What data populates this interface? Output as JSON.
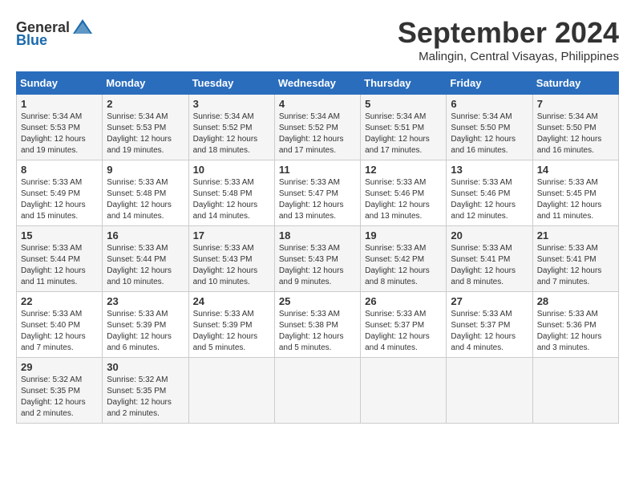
{
  "logo": {
    "general": "General",
    "blue": "Blue"
  },
  "title": "September 2024",
  "location": "Malingin, Central Visayas, Philippines",
  "headers": [
    "Sunday",
    "Monday",
    "Tuesday",
    "Wednesday",
    "Thursday",
    "Friday",
    "Saturday"
  ],
  "weeks": [
    [
      {
        "day": "1",
        "sunrise": "5:34 AM",
        "sunset": "5:53 PM",
        "daylight": "12 hours and 19 minutes."
      },
      {
        "day": "2",
        "sunrise": "5:34 AM",
        "sunset": "5:53 PM",
        "daylight": "12 hours and 19 minutes."
      },
      {
        "day": "3",
        "sunrise": "5:34 AM",
        "sunset": "5:52 PM",
        "daylight": "12 hours and 18 minutes."
      },
      {
        "day": "4",
        "sunrise": "5:34 AM",
        "sunset": "5:52 PM",
        "daylight": "12 hours and 17 minutes."
      },
      {
        "day": "5",
        "sunrise": "5:34 AM",
        "sunset": "5:51 PM",
        "daylight": "12 hours and 17 minutes."
      },
      {
        "day": "6",
        "sunrise": "5:34 AM",
        "sunset": "5:50 PM",
        "daylight": "12 hours and 16 minutes."
      },
      {
        "day": "7",
        "sunrise": "5:34 AM",
        "sunset": "5:50 PM",
        "daylight": "12 hours and 16 minutes."
      }
    ],
    [
      {
        "day": "8",
        "sunrise": "5:33 AM",
        "sunset": "5:49 PM",
        "daylight": "12 hours and 15 minutes."
      },
      {
        "day": "9",
        "sunrise": "5:33 AM",
        "sunset": "5:48 PM",
        "daylight": "12 hours and 14 minutes."
      },
      {
        "day": "10",
        "sunrise": "5:33 AM",
        "sunset": "5:48 PM",
        "daylight": "12 hours and 14 minutes."
      },
      {
        "day": "11",
        "sunrise": "5:33 AM",
        "sunset": "5:47 PM",
        "daylight": "12 hours and 13 minutes."
      },
      {
        "day": "12",
        "sunrise": "5:33 AM",
        "sunset": "5:46 PM",
        "daylight": "12 hours and 13 minutes."
      },
      {
        "day": "13",
        "sunrise": "5:33 AM",
        "sunset": "5:46 PM",
        "daylight": "12 hours and 12 minutes."
      },
      {
        "day": "14",
        "sunrise": "5:33 AM",
        "sunset": "5:45 PM",
        "daylight": "12 hours and 11 minutes."
      }
    ],
    [
      {
        "day": "15",
        "sunrise": "5:33 AM",
        "sunset": "5:44 PM",
        "daylight": "12 hours and 11 minutes."
      },
      {
        "day": "16",
        "sunrise": "5:33 AM",
        "sunset": "5:44 PM",
        "daylight": "12 hours and 10 minutes."
      },
      {
        "day": "17",
        "sunrise": "5:33 AM",
        "sunset": "5:43 PM",
        "daylight": "12 hours and 10 minutes."
      },
      {
        "day": "18",
        "sunrise": "5:33 AM",
        "sunset": "5:43 PM",
        "daylight": "12 hours and 9 minutes."
      },
      {
        "day": "19",
        "sunrise": "5:33 AM",
        "sunset": "5:42 PM",
        "daylight": "12 hours and 8 minutes."
      },
      {
        "day": "20",
        "sunrise": "5:33 AM",
        "sunset": "5:41 PM",
        "daylight": "12 hours and 8 minutes."
      },
      {
        "day": "21",
        "sunrise": "5:33 AM",
        "sunset": "5:41 PM",
        "daylight": "12 hours and 7 minutes."
      }
    ],
    [
      {
        "day": "22",
        "sunrise": "5:33 AM",
        "sunset": "5:40 PM",
        "daylight": "12 hours and 7 minutes."
      },
      {
        "day": "23",
        "sunrise": "5:33 AM",
        "sunset": "5:39 PM",
        "daylight": "12 hours and 6 minutes."
      },
      {
        "day": "24",
        "sunrise": "5:33 AM",
        "sunset": "5:39 PM",
        "daylight": "12 hours and 5 minutes."
      },
      {
        "day": "25",
        "sunrise": "5:33 AM",
        "sunset": "5:38 PM",
        "daylight": "12 hours and 5 minutes."
      },
      {
        "day": "26",
        "sunrise": "5:33 AM",
        "sunset": "5:37 PM",
        "daylight": "12 hours and 4 minutes."
      },
      {
        "day": "27",
        "sunrise": "5:33 AM",
        "sunset": "5:37 PM",
        "daylight": "12 hours and 4 minutes."
      },
      {
        "day": "28",
        "sunrise": "5:33 AM",
        "sunset": "5:36 PM",
        "daylight": "12 hours and 3 minutes."
      }
    ],
    [
      {
        "day": "29",
        "sunrise": "5:32 AM",
        "sunset": "5:35 PM",
        "daylight": "12 hours and 2 minutes."
      },
      {
        "day": "30",
        "sunrise": "5:32 AM",
        "sunset": "5:35 PM",
        "daylight": "12 hours and 2 minutes."
      },
      null,
      null,
      null,
      null,
      null
    ]
  ],
  "labels": {
    "sunrise": "Sunrise:",
    "sunset": "Sunset:",
    "daylight": "Daylight:"
  }
}
